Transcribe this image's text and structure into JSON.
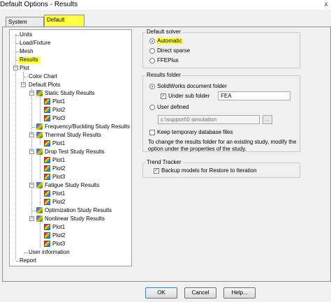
{
  "window": {
    "title": "Default Options - Results",
    "close_glyph": "x"
  },
  "tabs": [
    {
      "label": "System Options",
      "active": false
    },
    {
      "label": "Default Options",
      "active": true
    }
  ],
  "tree": {
    "items": {
      "units": "Units",
      "load_fixture": "Load/Fixture",
      "mesh": "Mesh",
      "results": "Results",
      "plot": "Plot",
      "color_chart": "Color Chart",
      "default_plots": "Default Plots",
      "static_study": "Static Study Results",
      "frequency_study": "Frequency/Buckling Study Results",
      "thermal_study": "Thermal Study Results",
      "drop_test_study": "Drop Test Study Results",
      "fatigue_study": "Fatigue Study Results",
      "optimization_study": "Optimization Study Results",
      "nonlinear_study": "Nonlinear Study Results",
      "user_information": "User information",
      "report": "Report"
    },
    "plot1": "Plot1",
    "plot2": "Plot2",
    "plot3": "Plot3",
    "expander_minus": "−"
  },
  "default_solver": {
    "label": "Default solver",
    "options": [
      "Automatic",
      "Direct sparse",
      "FFEPlus"
    ],
    "selected": "Automatic"
  },
  "results_folder": {
    "label": "Results folder",
    "solidworks_folder": "SolidWorks document folder",
    "under_sub_folder": "Under sub folder",
    "sub_folder_value": "FEA",
    "user_defined": "User defined",
    "user_path": "c:\\support\\0 simulation",
    "browse": "...",
    "keep_temp": "Keep temporary database files",
    "note": "To change the results folder for an existing study, modify the option under the properties of the study."
  },
  "trend_tracker": {
    "label": "Trend Tracker",
    "backup": "Backup models for Restore to Iteration"
  },
  "checkmark": "✓",
  "buttons": {
    "ok": "OK",
    "cancel": "Cancel",
    "help": "Help..."
  }
}
